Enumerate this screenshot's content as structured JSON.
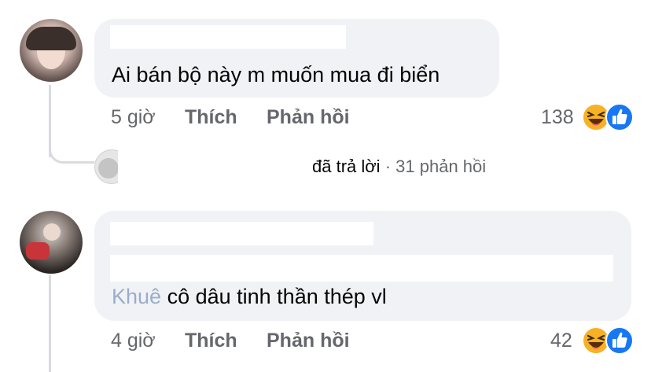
{
  "comments": [
    {
      "text": "Ai bán bộ này m muốn mua đi biển",
      "time": "5 giờ",
      "like_label": "Thích",
      "reply_label": "Phản hồi",
      "reaction_count": "138",
      "replies_summary": {
        "replied_label": "đã trả lời",
        "separator": "·",
        "count_label": "31 phản hồi"
      }
    },
    {
      "mention_tail": "Khuê",
      "text": "cô dâu tinh thần thép vl",
      "time": "4 giờ",
      "like_label": "Thích",
      "reply_label": "Phản hồi",
      "reaction_count": "42"
    }
  ],
  "colors": {
    "bubble_bg": "#f0f2f5",
    "secondary_text": "#65676b",
    "link_blue": "#385898",
    "like_blue": "#1877f2",
    "haha_yellow": "#f7b125"
  },
  "icons": [
    "haha-reaction-icon",
    "like-reaction-icon"
  ]
}
